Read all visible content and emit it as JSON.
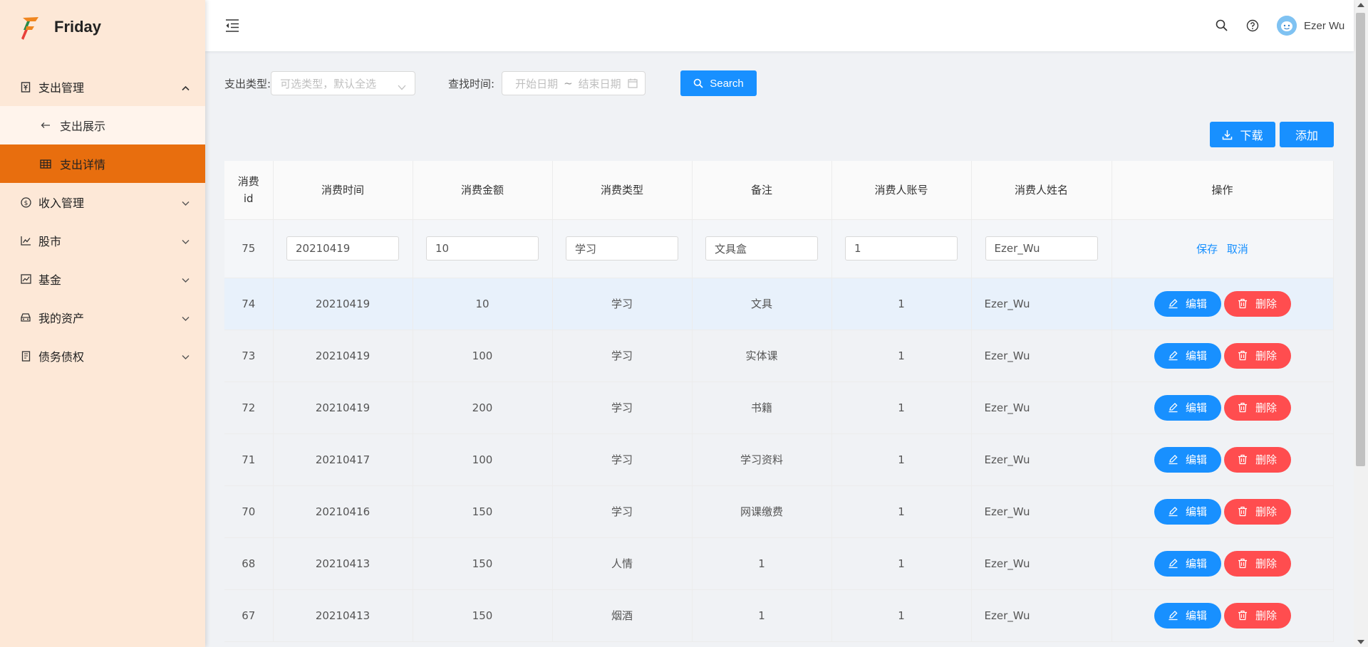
{
  "app": {
    "name": "Friday"
  },
  "colors": {
    "primary": "#1890ff",
    "danger": "#ff4d4f",
    "sidebar_bg": "#fde8d7",
    "active_menu": "#e86e0e"
  },
  "sidebar": {
    "menu": [
      {
        "label": "支出管理",
        "icon": "receipt-icon",
        "expanded": true,
        "children": [
          {
            "label": "支出展示",
            "icon": "arrow-left-icon",
            "active": false
          },
          {
            "label": "支出详情",
            "icon": "table-icon",
            "active": true
          }
        ]
      },
      {
        "label": "收入管理",
        "icon": "dollar-circle-icon"
      },
      {
        "label": "股市",
        "icon": "line-chart-icon"
      },
      {
        "label": "基金",
        "icon": "stock-chart-icon"
      },
      {
        "label": "我的资产",
        "icon": "car-icon"
      },
      {
        "label": "债务债权",
        "icon": "ledger-icon"
      }
    ]
  },
  "header": {
    "user_name": "Ezer Wu"
  },
  "filters": {
    "type_label": "支出类型:",
    "type_placeholder": "可选类型，默认全选",
    "time_label": "查找时间:",
    "start_placeholder": "开始日期",
    "separator": "~",
    "end_placeholder": "结束日期",
    "search_label": "Search"
  },
  "actions": {
    "download_label": "下载",
    "add_label": "添加"
  },
  "table": {
    "columns": [
      "消费id",
      "消费时间",
      "消费金额",
      "消费类型",
      "备注",
      "消费人账号",
      "消费人姓名",
      "操作"
    ],
    "edit_row": {
      "id": "75",
      "time": "20210419",
      "amount": "10",
      "type": "学习",
      "note": "文具盒",
      "account": "1",
      "name": "Ezer_Wu",
      "save_label": "保存",
      "cancel_label": "取消"
    },
    "rows": [
      {
        "id": "74",
        "time": "20210419",
        "amount": "10",
        "type": "学习",
        "note": "文具",
        "account": "1",
        "name": "Ezer_Wu"
      },
      {
        "id": "73",
        "time": "20210419",
        "amount": "100",
        "type": "学习",
        "note": "实体课",
        "account": "1",
        "name": "Ezer_Wu"
      },
      {
        "id": "72",
        "time": "20210419",
        "amount": "200",
        "type": "学习",
        "note": "书籍",
        "account": "1",
        "name": "Ezer_Wu"
      },
      {
        "id": "71",
        "time": "20210417",
        "amount": "100",
        "type": "学习",
        "note": "学习资料",
        "account": "1",
        "name": "Ezer_Wu"
      },
      {
        "id": "70",
        "time": "20210416",
        "amount": "150",
        "type": "学习",
        "note": "网课缴费",
        "account": "1",
        "name": "Ezer_Wu"
      },
      {
        "id": "68",
        "time": "20210413",
        "amount": "150",
        "type": "人情",
        "note": "1",
        "account": "1",
        "name": "Ezer_Wu"
      },
      {
        "id": "67",
        "time": "20210413",
        "amount": "150",
        "type": "烟酒",
        "note": "1",
        "account": "1",
        "name": "Ezer_Wu"
      }
    ],
    "edit_label": "编辑",
    "delete_label": "删除"
  }
}
